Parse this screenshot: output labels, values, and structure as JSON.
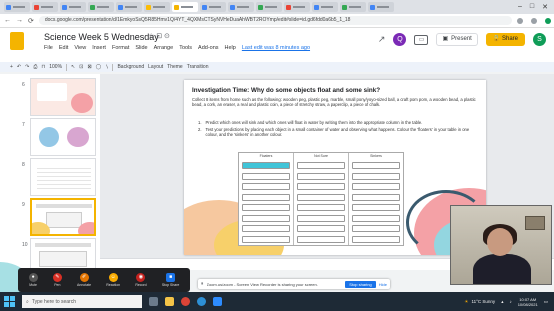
{
  "browser": {
    "url": "docs.google.com/presentation/d/1EmkyoSsQ5R85Hmv1Q/4YT_4QXMsCTSyNVHeDuaAhWBT2ROYmp/edit#slide=id.gd6fdd0a6b5_1_18",
    "nav_back": "←",
    "nav_forward": "→",
    "nav_reload": "⟳",
    "win_min": "–",
    "win_max": "□",
    "win_close": "✕"
  },
  "app": {
    "title": "Science Week 5 Wednesday",
    "star": "☆ ⊡ ⊙",
    "menu": [
      "File",
      "Edit",
      "View",
      "Insert",
      "Format",
      "Slide",
      "Arrange",
      "Tools",
      "Add-ons",
      "Help"
    ],
    "last_edit": "Last edit was 8 minutes ago",
    "present_label": "Present",
    "share_label": "Share",
    "avatar_letter": "S",
    "comment_letter": "Q"
  },
  "toolbar": {
    "items": [
      "+",
      "↶",
      "↷",
      "⎙",
      "⊓",
      "100%",
      "↖",
      "⊡",
      "⊠",
      "◯",
      "∖",
      "Background",
      "Layout",
      "Theme",
      "Transition"
    ]
  },
  "filmstrip": {
    "numbers": [
      "6",
      "7",
      "8",
      "9",
      "10"
    ],
    "selected": "9"
  },
  "slide": {
    "title": "Investigation Time: Why do some objects float and some sink?",
    "intro": "Collect 8 items from home such as the following: wooden peg, plastic peg, marble, small pony/yoyo-sized ball, a craft pom pom, a wooden bead, a plastic bead, a cork, an eraser, a real and plastic coin, a piece of stretchy straw, a paperclip, a piece of chalk.",
    "steps": [
      {
        "num": "1.",
        "text": "Predict which ones will sink and which ones will float in water by writing them into the appropriate column in the table."
      },
      {
        "num": "2.",
        "text": "Test your predictions by placing each object in a small container of water and observing what happens. Colour the 'floaters' in your table in one colour, and the 'sinkers' in another colour."
      }
    ],
    "table_headers": [
      "Floaters",
      "Not Sure",
      "Sinkers"
    ],
    "rows_per_col": 8
  },
  "sharebar": {
    "text": "Zoom.us/zoom - Screen View Recorder is sharing your screen.",
    "stop_label": "Stop sharing",
    "hide_label": "Hide"
  },
  "meeting": {
    "controls": [
      "Mute",
      "Pen",
      "Annotate",
      "Reaction",
      "Record",
      "Stop Share"
    ]
  },
  "taskbar": {
    "search_placeholder": "Type here to search",
    "weather": "11°C  Sunny",
    "time": "10:07 AM",
    "date": "10/08/2021"
  },
  "colors": {
    "accent": "#f4b400",
    "stop_share": "#1a73e8"
  }
}
